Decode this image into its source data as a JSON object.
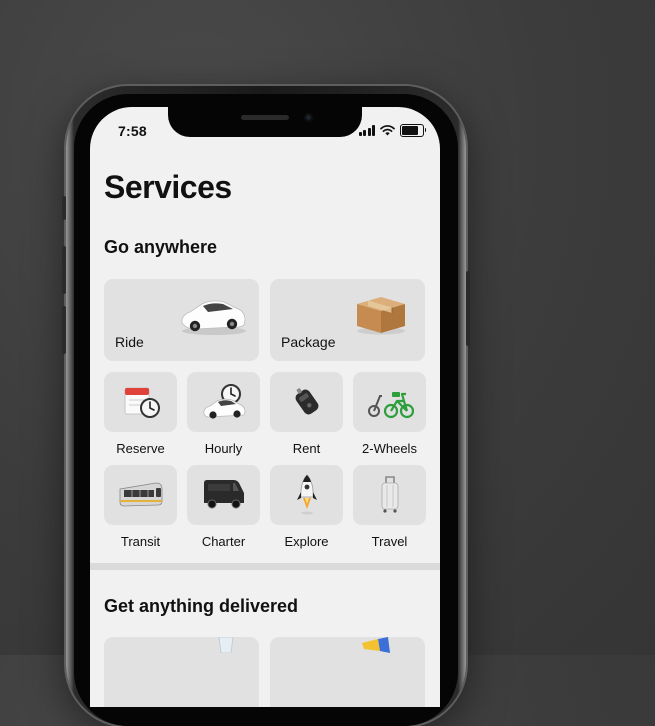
{
  "status_bar": {
    "time": "7:58"
  },
  "page": {
    "title": "Services"
  },
  "sections": [
    {
      "title": "Go anywhere",
      "featured": [
        {
          "label": "Ride",
          "icon": "car-icon"
        },
        {
          "label": "Package",
          "icon": "package-icon"
        }
      ],
      "items": [
        {
          "label": "Reserve",
          "icon": "calendar-clock-icon"
        },
        {
          "label": "Hourly",
          "icon": "car-clock-icon"
        },
        {
          "label": "Rent",
          "icon": "car-key-icon"
        },
        {
          "label": "2-Wheels",
          "icon": "bike-scooter-icon"
        },
        {
          "label": "Transit",
          "icon": "train-icon"
        },
        {
          "label": "Charter",
          "icon": "van-icon"
        },
        {
          "label": "Explore",
          "icon": "rocket-icon"
        },
        {
          "label": "Travel",
          "icon": "luggage-icon"
        }
      ]
    },
    {
      "title": "Get anything delivered"
    }
  ],
  "colors": {
    "tile": "#e1e1e1",
    "screen": "#f1f1f1",
    "background": "#3c3c3c",
    "text": "#111111"
  }
}
